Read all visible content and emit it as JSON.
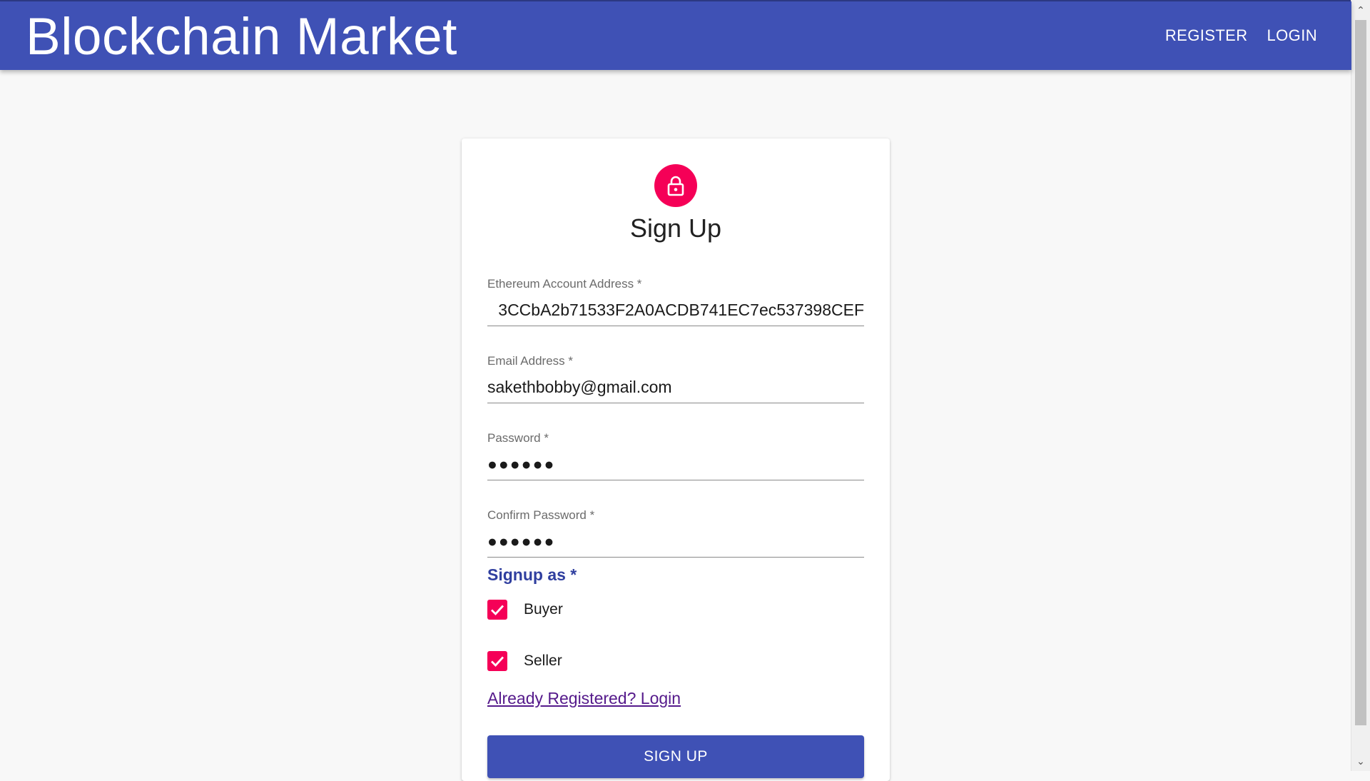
{
  "app": {
    "title": "Blockchain Market",
    "nav": {
      "register": "REGISTER",
      "login": "LOGIN"
    }
  },
  "colors": {
    "primary": "#3f51b5",
    "accent": "#f50057",
    "link": "#551a8b"
  },
  "form": {
    "title": "Sign Up",
    "icon": "lock-icon",
    "fields": {
      "eth_address": {
        "label": "Ethereum Account Address *",
        "value": "3CCbA2b71533F2A0ACDB741EC7ec537398CEF"
      },
      "email": {
        "label": "Email Address *",
        "value": "sakethbobby@gmail.com"
      },
      "password": {
        "label": "Password *",
        "value": "●●●●●●"
      },
      "confirm_password": {
        "label": "Confirm Password *",
        "value": "●●●●●●"
      }
    },
    "signup_as": {
      "label": "Signup as *",
      "options": [
        {
          "label": "Buyer",
          "checked": true
        },
        {
          "label": "Seller",
          "checked": true
        }
      ]
    },
    "login_link": "Already Registered? Login",
    "submit": "SIGN UP"
  }
}
